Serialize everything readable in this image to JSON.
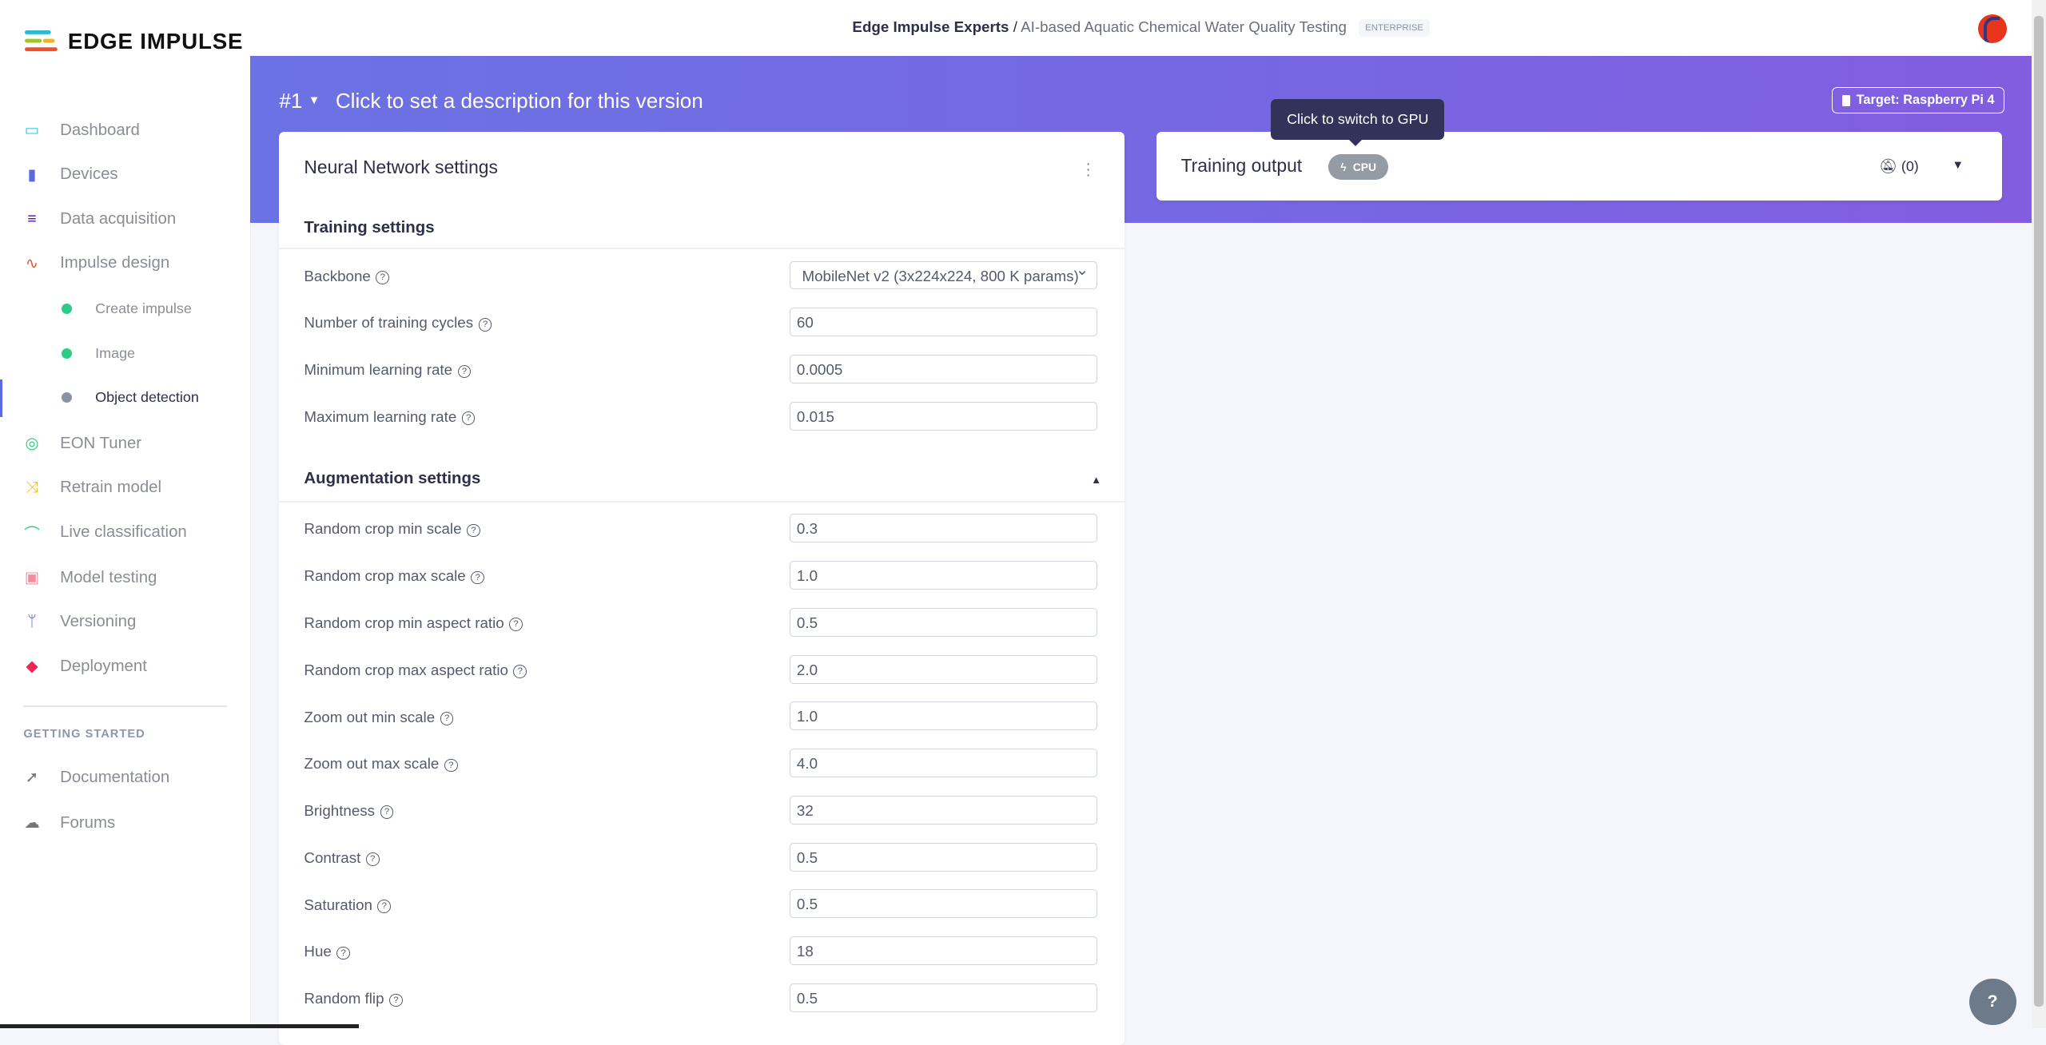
{
  "brand": {
    "name": "EDGE IMPULSE"
  },
  "sidebar": {
    "items": [
      {
        "label": "Dashboard",
        "icon": "monitor-icon",
        "color": "#22c4e6"
      },
      {
        "label": "Devices",
        "icon": "chip-icon",
        "color": "#5b6ae0"
      },
      {
        "label": "Data acquisition",
        "icon": "database-icon",
        "color": "#4b14a8"
      },
      {
        "label": "Impulse design",
        "icon": "pulse-icon",
        "color": "#f0533a"
      },
      {
        "label": "Create impulse",
        "icon": "dot-icon",
        "color": "#2bcc83"
      },
      {
        "label": "Image",
        "icon": "dot-icon",
        "color": "#2bcc83"
      },
      {
        "label": "Object detection",
        "icon": "dot-icon",
        "color": "#8893a8"
      },
      {
        "label": "EON Tuner",
        "icon": "compass-icon",
        "color": "#2bcc83"
      },
      {
        "label": "Retrain model",
        "icon": "shuffle-icon",
        "color": "#f5c518"
      },
      {
        "label": "Live classification",
        "icon": "vector-icon",
        "color": "#2bcc83"
      },
      {
        "label": "Model testing",
        "icon": "clipboard-check-icon",
        "color": "#f08ca0"
      },
      {
        "label": "Versioning",
        "icon": "branch-icon",
        "color": "#5b6ae0"
      },
      {
        "label": "Deployment",
        "icon": "cube-icon",
        "color": "#f0244f"
      }
    ],
    "section_label": "GETTING STARTED",
    "extra": [
      {
        "label": "Documentation",
        "icon": "rocket-icon"
      },
      {
        "label": "Forums",
        "icon": "comments-icon"
      }
    ]
  },
  "header": {
    "org": "Edge Impulse Experts",
    "separator": "/",
    "project": "AI-based Aquatic Chemical Water Quality Testing",
    "badge": "ENTERPRISE"
  },
  "version": {
    "number": "#1",
    "description_placeholder": "Click to set a description for this version"
  },
  "target": {
    "label": "Target: Raspberry Pi 4"
  },
  "nn": {
    "title": "Neural Network settings",
    "training_title": "Training settings",
    "training": [
      {
        "label": "Backbone",
        "value": "MobileNet v2 (3x224x224, 800 K params)",
        "type": "select"
      },
      {
        "label": "Number of training cycles",
        "value": "60"
      },
      {
        "label": "Minimum learning rate",
        "value": "0.0005"
      },
      {
        "label": "Maximum learning rate",
        "value": "0.015"
      }
    ],
    "augmentation_title": "Augmentation settings",
    "augmentation": [
      {
        "label": "Random crop min scale",
        "value": "0.3"
      },
      {
        "label": "Random crop max scale",
        "value": "1.0"
      },
      {
        "label": "Random crop min aspect ratio",
        "value": "0.5"
      },
      {
        "label": "Random crop max aspect ratio",
        "value": "2.0"
      },
      {
        "label": "Zoom out min scale",
        "value": "1.0"
      },
      {
        "label": "Zoom out max scale",
        "value": "4.0"
      },
      {
        "label": "Brightness",
        "value": "32"
      },
      {
        "label": "Contrast",
        "value": "0.5"
      },
      {
        "label": "Saturation",
        "value": "0.5"
      },
      {
        "label": "Hue",
        "value": "18"
      },
      {
        "label": "Random flip",
        "value": "0.5"
      }
    ]
  },
  "training_output": {
    "title": "Training output",
    "cpu_label": "CPU",
    "notifications": "(0)",
    "tooltip": "Click to switch to GPU"
  },
  "help": {
    "label": "?"
  }
}
